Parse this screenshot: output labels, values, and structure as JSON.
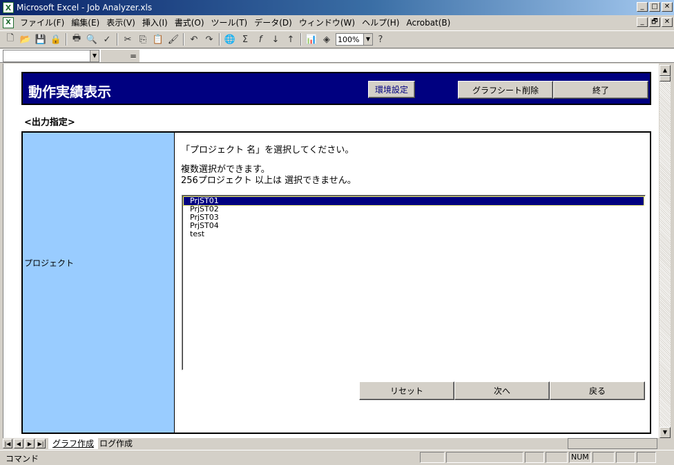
{
  "window": {
    "title": "Microsoft Excel - Job Analyzer.xls",
    "app_icon": "X",
    "minimize": "_",
    "maximize": "□",
    "close": "✕",
    "restore": "🗗"
  },
  "menubar": {
    "items": [
      "ファイル(F)",
      "編集(E)",
      "表示(V)",
      "挿入(I)",
      "書式(O)",
      "ツール(T)",
      "データ(D)",
      "ウィンドウ(W)",
      "ヘルプ(H)",
      "Acrobat(B)"
    ]
  },
  "toolbar": {
    "zoom": "100%",
    "help_glyph": "?"
  },
  "formulabar": {
    "fx": "="
  },
  "form": {
    "title": "動作実績表示",
    "env_button": "環境設定",
    "delete_graph_button": "グラフシート削除",
    "exit_button": "終了",
    "section_label": "<出力指定>",
    "row_label": "プロジェクト",
    "instruction_1": "「プロジェクト 名」を選択してください。",
    "instruction_2": "複数選択ができます。",
    "instruction_3": "256プロジェクト 以上は 選択できません。",
    "projects": [
      {
        "name": "PrjST01",
        "selected": true
      },
      {
        "name": "PrjST02",
        "selected": false
      },
      {
        "name": "PrjST03",
        "selected": false
      },
      {
        "name": "PrjST04",
        "selected": false
      },
      {
        "name": "test",
        "selected": false
      }
    ],
    "reset_button": "リセット",
    "next_button": "次へ",
    "back_button": "戻る"
  },
  "tabs": {
    "sheet_1": "グラフ作成",
    "sheet_2": "ログ作成"
  },
  "statusbar": {
    "mode": "コマンド",
    "num": "NUM"
  },
  "colors": {
    "header_band": "#000080",
    "label_panel": "#99ccff",
    "selection": "#000080"
  }
}
